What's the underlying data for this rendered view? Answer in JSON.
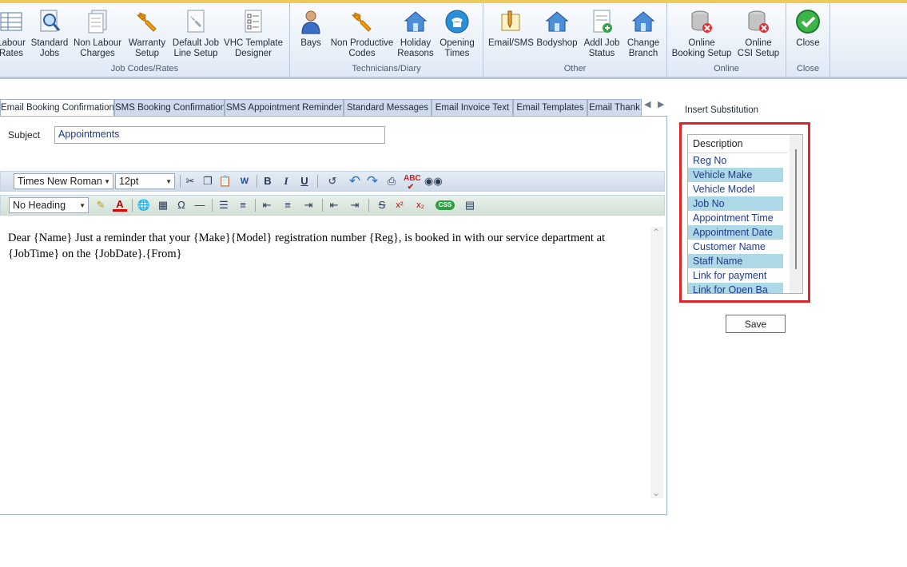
{
  "ribbon": {
    "groups": [
      {
        "label": "Job Codes/Rates",
        "buttons": [
          {
            "label": "Labour\nRates",
            "icon": "grid-table-icon"
          },
          {
            "label": "Standard\nJobs",
            "icon": "magnifier-doc-icon"
          },
          {
            "label": "Non Labour\nCharges",
            "icon": "documents-stack-icon"
          },
          {
            "label": "Warranty\nSetup",
            "icon": "wrench-icon"
          },
          {
            "label": "Default Job\nLine Setup",
            "icon": "wrench-doc-icon"
          },
          {
            "label": "VHC Template\nDesigner",
            "icon": "checklist-icon"
          }
        ]
      },
      {
        "label": "Technicians/Diary",
        "buttons": [
          {
            "label": "Bays",
            "icon": "person-icon"
          },
          {
            "label": "Non Productive\nCodes",
            "icon": "wrench-icon"
          },
          {
            "label": "Holiday\nReasons",
            "icon": "house-icon"
          },
          {
            "label": "Opening\nTimes",
            "icon": "phone-icon"
          }
        ]
      },
      {
        "label": "Other",
        "buttons": [
          {
            "label": "Email/SMS",
            "icon": "pencil-note-icon"
          },
          {
            "label": "Bodyshop",
            "icon": "house-icon"
          },
          {
            "label": "Addl Job\nStatus",
            "icon": "doc-add-icon"
          },
          {
            "label": "Change\nBranch",
            "icon": "house-icon"
          }
        ]
      },
      {
        "label": "Online",
        "buttons": [
          {
            "label": "Online\nBooking Setup",
            "icon": "database-delete-icon"
          },
          {
            "label": "Online\nCSI Setup",
            "icon": "database-delete-icon"
          }
        ]
      },
      {
        "label": "Close",
        "buttons": [
          {
            "label": "Close",
            "icon": "green-check-icon"
          }
        ]
      }
    ]
  },
  "tabs": [
    {
      "label": "Email Booking Confirmation",
      "active": true
    },
    {
      "label": "SMS Booking Confirmation",
      "active": false
    },
    {
      "label": "SMS Appointment Reminder",
      "active": false
    },
    {
      "label": "Standard Messages",
      "active": false
    },
    {
      "label": "Email Invoice Text",
      "active": false
    },
    {
      "label": "Email Templates",
      "active": false
    },
    {
      "label": "Email Thank",
      "active": false
    }
  ],
  "editor": {
    "subject_label": "Subject",
    "subject_value": "Appointments",
    "font_name": "Times New Roman",
    "font_size": "12pt",
    "heading": "No Heading",
    "body": "Dear {Name} Just a reminder that your {Make}{Model} registration number {Reg}, is booked in with our service department at {JobTime} on the {JobDate}.{From}"
  },
  "substitution": {
    "label": "Insert Substitution",
    "header": "Description",
    "items": [
      {
        "label": "Reg No",
        "highlight": false
      },
      {
        "label": "Vehicle Make",
        "highlight": true
      },
      {
        "label": "Vehicle Model",
        "highlight": false
      },
      {
        "label": "Job No",
        "highlight": true
      },
      {
        "label": "Appointment Time",
        "highlight": false
      },
      {
        "label": "Appointment Date",
        "highlight": true
      },
      {
        "label": "Customer Name",
        "highlight": false
      },
      {
        "label": "Staff Name",
        "highlight": true
      },
      {
        "label": "Link for payment",
        "highlight": false
      },
      {
        "label": "Link for Open Ba",
        "highlight": true
      }
    ]
  },
  "save_label": "Save",
  "colors": {
    "highlight_box": "#e0252a",
    "list_highlight": "#add8e6",
    "link_text": "#1f3a8a"
  }
}
